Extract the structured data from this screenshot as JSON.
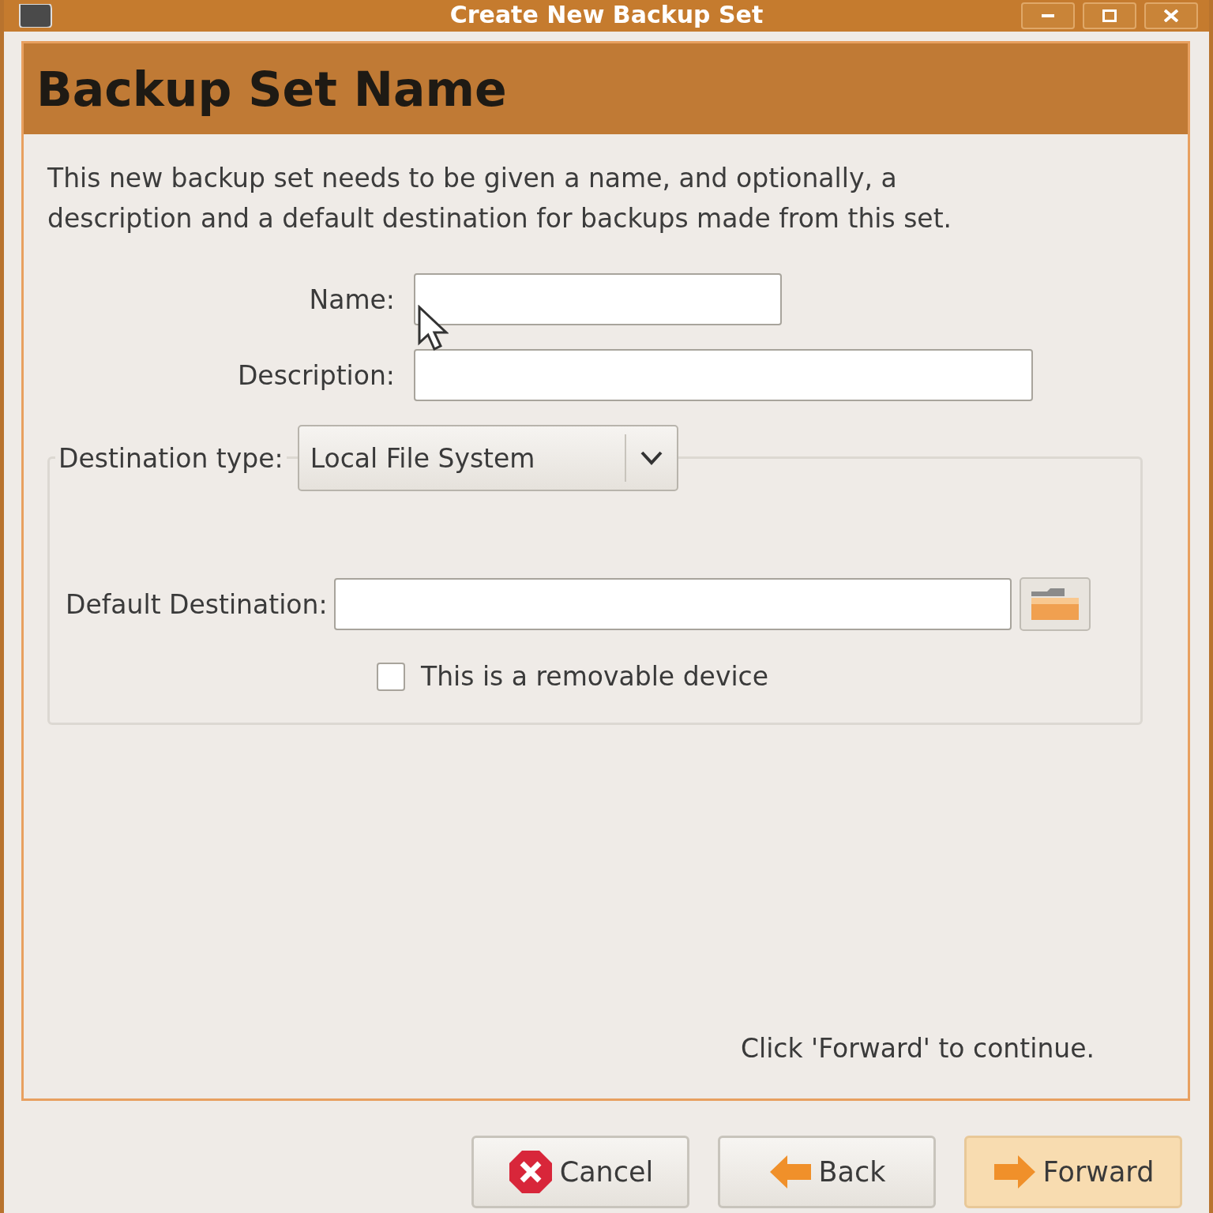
{
  "window": {
    "title": "Create New Backup Set"
  },
  "header": {
    "title": "Backup Set Name"
  },
  "intro": "This new backup set needs to be given a name, and optionally, a description and a default destination for backups made from this set.",
  "fields": [
    {
      "label": "Name:"
    },
    {
      "label": "Description:"
    }
  ],
  "destination": {
    "label": "Destination type:",
    "value": "Local File System",
    "default_label": "Default Destination:",
    "removable": {
      "label": "This is a removable device",
      "checked": false
    }
  },
  "hint": "Click 'Forward' to continue.",
  "buttons": [
    {
      "label": "Cancel",
      "kind": "cancel",
      "focused": false
    },
    {
      "label": "Back",
      "kind": "back",
      "focused": false
    },
    {
      "label": "Forward",
      "kind": "forward",
      "focused": true
    }
  ]
}
